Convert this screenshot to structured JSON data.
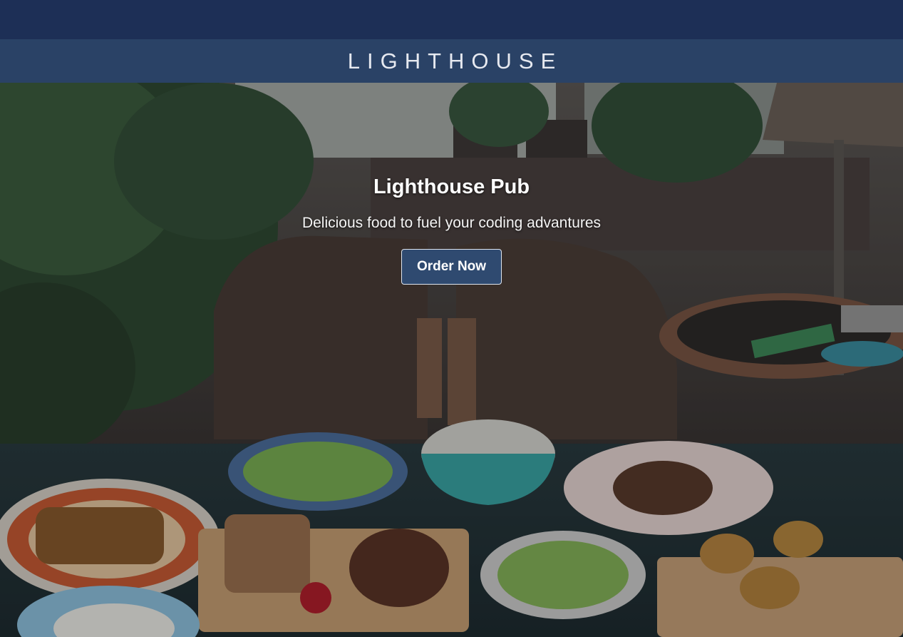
{
  "header": {
    "brand": "LIGHTHOUSE"
  },
  "hero": {
    "title": "Lighthouse Pub",
    "subtitle": "Delicious food to fuel your coding advantures",
    "cta_label": "Order Now",
    "background_image": "restaurant-table-with-food-photo"
  },
  "colors": {
    "top_bar": "#1d2f56",
    "brand_bar": "#2a4266",
    "button": "#2f4a70"
  }
}
